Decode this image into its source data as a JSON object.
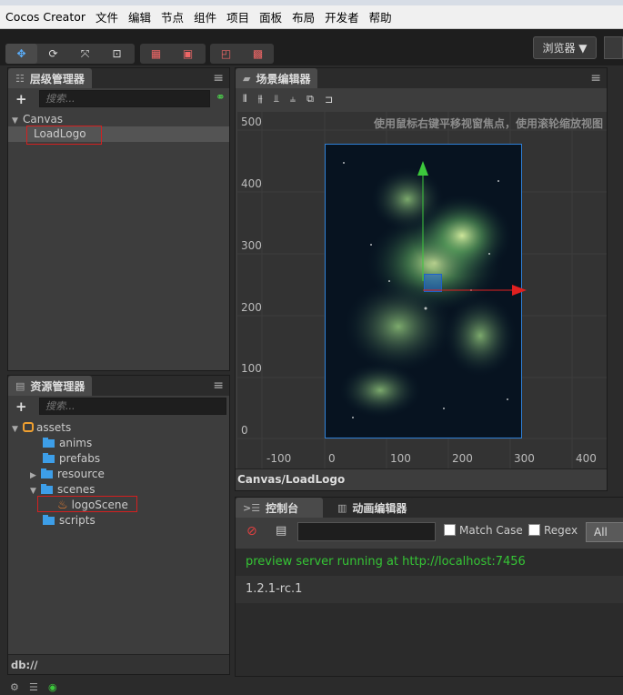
{
  "menubar": [
    "Cocos Creator",
    "文件",
    "编辑",
    "节点",
    "组件",
    "项目",
    "面板",
    "布局",
    "开发者",
    "帮助"
  ],
  "toolbar": {
    "browser_label": "浏览器"
  },
  "hierarchy": {
    "title": "层级管理器",
    "search_placeholder": "搜索...",
    "root": "Canvas",
    "child": "LoadLogo"
  },
  "assets": {
    "title": "资源管理器",
    "search_placeholder": "搜索...",
    "root": "assets",
    "items": [
      "anims",
      "prefabs",
      "resource",
      "scenes",
      "logoScene",
      "scripts"
    ],
    "footer": "db://"
  },
  "scene": {
    "title": "场景编辑器",
    "hint": "使用鼠标右键平移视窗焦点，使用滚轮缩放视图",
    "y_labels": [
      "500",
      "400",
      "300",
      "200",
      "100",
      "0"
    ],
    "x_labels": [
      "-100",
      "0",
      "100",
      "200",
      "300",
      "400"
    ],
    "footer": "Canvas/LoadLogo"
  },
  "console": {
    "tab1": "控制台",
    "tab2": "动画编辑器",
    "match_case": "Match Case",
    "regex": "Regex",
    "filter": "All",
    "lines": [
      "preview server running at http://localhost:7456",
      "1.2.1-rc.1"
    ],
    "colors": {
      "server_line": "#35c435",
      "normal": "#cccccc"
    }
  }
}
